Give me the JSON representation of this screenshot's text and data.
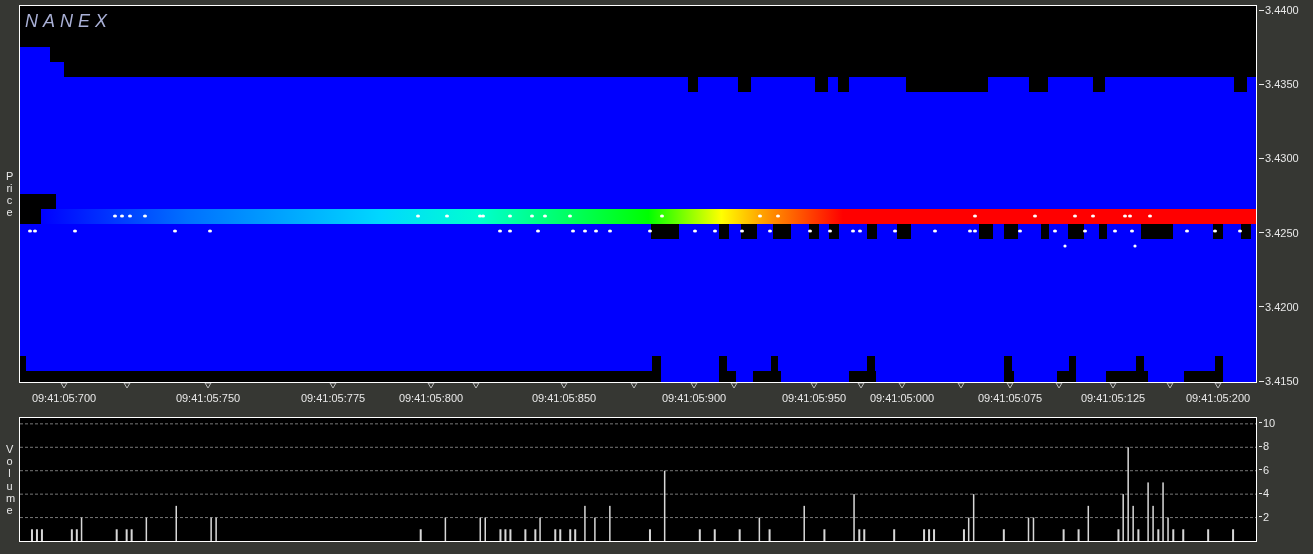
{
  "logo": "NANEX",
  "price_chart": {
    "axis_label": "Price",
    "price_ticks": [
      "3.4400",
      "3.4350",
      "3.4300",
      "3.4250",
      "3.4200",
      "3.4150"
    ],
    "time_ticks": [
      "09:41:05:700",
      "09:41:05:750",
      "09:41:05:775",
      "09:41:05:800",
      "09:41:05:850",
      "09:41:05:900",
      "09:41:05:950",
      "09:41:05:000",
      "09:41:05:075",
      "09:41:05:125",
      "09:41:05:200"
    ]
  },
  "volume_chart": {
    "chart_data": {
      "type": "bar",
      "ylabel": "Volume",
      "ylim": [
        0,
        10.5
      ],
      "grid": true,
      "yticks": [
        {
          "value": 2,
          "label": "2"
        },
        {
          "value": 4,
          "label": "4"
        },
        {
          "value": 6,
          "label": "6"
        },
        {
          "value": 8,
          "label": "8"
        },
        {
          "value": 10,
          "label": "10"
        }
      ],
      "values": [
        null,
        null,
        1,
        1,
        1,
        null,
        null,
        null,
        null,
        null,
        1,
        1,
        2,
        null,
        null,
        null,
        null,
        null,
        null,
        1,
        null,
        1,
        1,
        null,
        null,
        2,
        null,
        null,
        null,
        null,
        null,
        3,
        null,
        null,
        null,
        null,
        null,
        null,
        2,
        2,
        null,
        null,
        null,
        null,
        null,
        null,
        null,
        null,
        null,
        null,
        null,
        null,
        null,
        null,
        null,
        null,
        null,
        null,
        null,
        null,
        null,
        null,
        null,
        null,
        null,
        null,
        null,
        null,
        null,
        null,
        null,
        null,
        null,
        null,
        null,
        null,
        null,
        null,
        null,
        null,
        1,
        null,
        null,
        null,
        null,
        2,
        null,
        null,
        null,
        null,
        null,
        null,
        2,
        2,
        null,
        null,
        1,
        1,
        1,
        null,
        null,
        1,
        null,
        1,
        2,
        null,
        null,
        1,
        1,
        null,
        1,
        1,
        null,
        3,
        null,
        2,
        null,
        null,
        3,
        null,
        null,
        null,
        null,
        null,
        null,
        null,
        1,
        null,
        null,
        6,
        null,
        null,
        null,
        null,
        null,
        null,
        1,
        null,
        null,
        1,
        null,
        null,
        null,
        null,
        1,
        null,
        null,
        null,
        2,
        null,
        1,
        null,
        null,
        null,
        null,
        null,
        null,
        3,
        null,
        null,
        null,
        1,
        null,
        null,
        null,
        null,
        null,
        4,
        1,
        1,
        null,
        null,
        null,
        null,
        null,
        1,
        null,
        null,
        null,
        null,
        null,
        1,
        1,
        1,
        null,
        null,
        null,
        null,
        null,
        1,
        2,
        4,
        null,
        null,
        null,
        null,
        null,
        1,
        null,
        null,
        null,
        null,
        2,
        2,
        null,
        null,
        null,
        null,
        null,
        1,
        null,
        null,
        1,
        null,
        3,
        null,
        null,
        null,
        null,
        null,
        1,
        4,
        8,
        3,
        1,
        null,
        5,
        3,
        1,
        5,
        2,
        1,
        null,
        1,
        null,
        null,
        null,
        null,
        1,
        null,
        null,
        null,
        null,
        1,
        null,
        null,
        null,
        null
      ]
    }
  }
}
